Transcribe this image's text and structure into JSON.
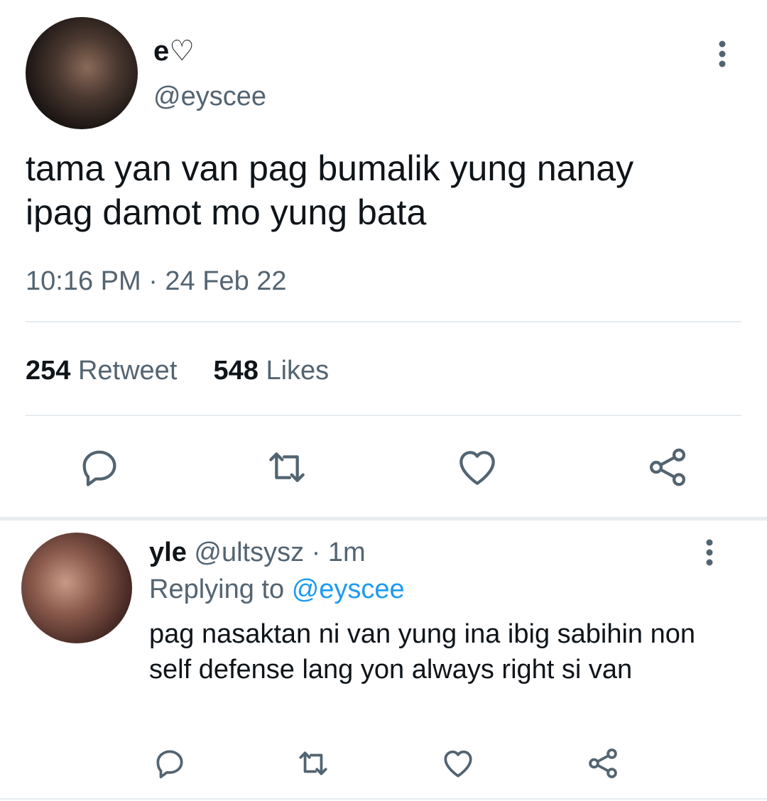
{
  "main_tweet": {
    "display_name": "e♡",
    "handle": "@eyscee",
    "text": "tama yan van pag bumalik yung nanay\nipag damot mo yung bata",
    "timestamp": "10:16 PM · 24 Feb 22",
    "retweet_count": "254",
    "retweet_label": "Retweet",
    "likes_count": "548",
    "likes_label": "Likes",
    "icons": [
      "reply-icon",
      "retweet-icon",
      "like-icon",
      "share-icon",
      "more-icon"
    ]
  },
  "reply_tweet": {
    "display_name": "yle",
    "handle_meta": "@ultsysz · 1m",
    "replying_to_label": "Replying to",
    "replying_to_handle": "@eyscee",
    "text": "pag nasaktan ni van yung ina ibig sabihin non self defense lang yon always right si van",
    "icons": [
      "reply-icon",
      "retweet-icon",
      "like-icon",
      "share-icon",
      "more-icon"
    ]
  },
  "colors": {
    "text_primary": "#0f1419",
    "text_secondary": "#536471",
    "link": "#1d9bf0",
    "divider": "#e6ecf0"
  }
}
